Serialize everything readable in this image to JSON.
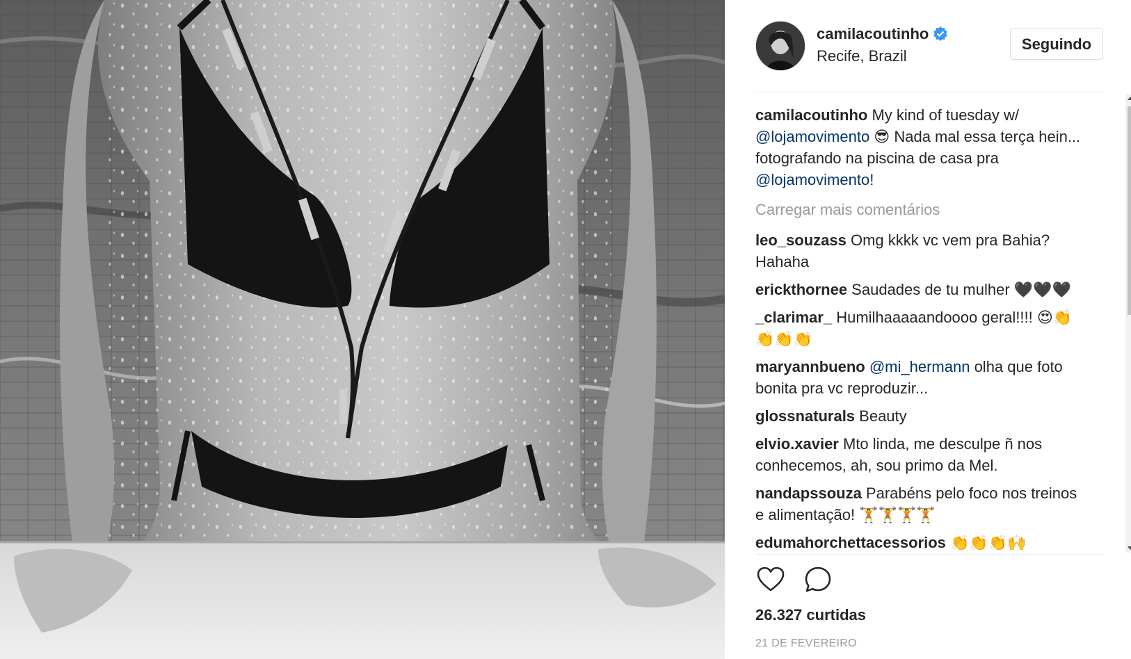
{
  "post": {
    "image_icon": "photo",
    "username": "camilacoutinho",
    "verified_icon": "verified-badge-icon",
    "location": "Recife, Brazil",
    "follow_label": "Seguindo"
  },
  "caption": {
    "username": "camilacoutinho",
    "text_1": " My kind of tuesday w/ ",
    "mention_1": "@lojamovimento",
    "text_2": " 😎 Nada mal essa terça hein... fotografando na piscina de casa pra ",
    "mention_2": "@lojamovimento",
    "text_3": "!"
  },
  "load_more_label": "Carregar mais comentários",
  "comments": [
    {
      "username": "leo_souzass",
      "text": " Omg kkkk vc vem pra Bahia? Hahaha"
    },
    {
      "username": "erickthornee",
      "text": " Saudades de tu mulher 🖤🖤🖤"
    },
    {
      "username": "_clarimar_",
      "text": " Humilhaaaaandoooo geral!!!! 😍👏👏👏👏"
    },
    {
      "username": "maryannbueno",
      "mention": "@mi_hermann",
      "text": " olha que foto bonita pra vc reproduzir..."
    },
    {
      "username": "glossnaturals",
      "text": " Beauty"
    },
    {
      "username": "elvio.xavier",
      "text": " Mto linda, me desculpe ñ nos conhecemos, ah, sou primo da Mel."
    },
    {
      "username": "nandapssouza",
      "text": " Parabéns pelo foco nos treinos e alimentação! 🏋🏋🏋🏋"
    },
    {
      "username": "edumahorchettacessorios",
      "text": " 👏👏👏🙌"
    }
  ],
  "actions": {
    "like_icon": "heart-icon",
    "comment_icon": "comment-icon"
  },
  "likes_text": "26.327 curtidas",
  "date_text": "21 DE FEVEREIRO",
  "colors": {
    "mention": "#003569",
    "muted": "#999999",
    "verified": "#3897f0",
    "text": "#262626"
  }
}
